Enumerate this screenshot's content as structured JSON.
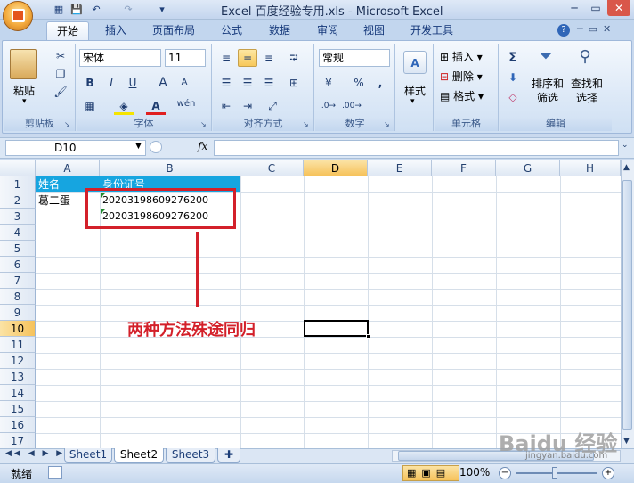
{
  "window": {
    "title": "Excel 百度经验专用.xls - Microsoft Excel",
    "help_glyph": "?",
    "minimize": "─",
    "restore": "▭",
    "close": "✕"
  },
  "quick_access": [
    "💾",
    "↶",
    "↷",
    "▾"
  ],
  "ribbon_tabs": [
    "开始",
    "插入",
    "页面布局",
    "公式",
    "数据",
    "审阅",
    "视图",
    "开发工具"
  ],
  "ribbon": {
    "clipboard": {
      "label": "剪贴板",
      "paste": "粘贴"
    },
    "font": {
      "label": "字体",
      "font_name": "宋体",
      "font_size": "11",
      "bold": "B",
      "italic": "I",
      "underline": "U",
      "grow": "A",
      "shrink": "A",
      "wen": "wén"
    },
    "alignment": {
      "label": "对齐方式"
    },
    "number": {
      "label": "数字",
      "format": "常规",
      "percent": "%",
      "comma": ","
    },
    "styles": {
      "label": "",
      "style_btn": "样式"
    },
    "cells": {
      "label": "单元格",
      "insert": "插入",
      "delete": "删除",
      "format": "格式"
    },
    "editing": {
      "label": "编辑",
      "sum": "Σ",
      "sort_filter_1": "排序和",
      "sort_filter_2": "筛选",
      "find_select_1": "查找和",
      "find_select_2": "选择"
    }
  },
  "formula_bar": {
    "name_box": "D10",
    "fx": "fx",
    "value": ""
  },
  "grid": {
    "columns": [
      "A",
      "B",
      "C",
      "D",
      "E",
      "F",
      "G",
      "H"
    ],
    "rows": [
      "1",
      "2",
      "3",
      "4",
      "5",
      "6",
      "7",
      "8",
      "9",
      "10",
      "11",
      "12",
      "13",
      "14",
      "15",
      "16",
      "17"
    ],
    "selected_column": "D",
    "selected_row": "10",
    "cells": {
      "A1": "姓名",
      "B1": "身份证号",
      "A2": "葛二蛋",
      "B2": "20203198609276200",
      "B3": "20203198609276200"
    }
  },
  "annotation": {
    "text": "两种方法殊途同归",
    "color": "#d3202a"
  },
  "sheets": [
    "Sheet1",
    "Sheet2",
    "Sheet3"
  ],
  "active_sheet": "Sheet2",
  "status": {
    "ready": "就绪",
    "zoom": "100%"
  },
  "watermark": {
    "text": "Baidu 经验",
    "sub": "jingyan.baidu.com"
  }
}
